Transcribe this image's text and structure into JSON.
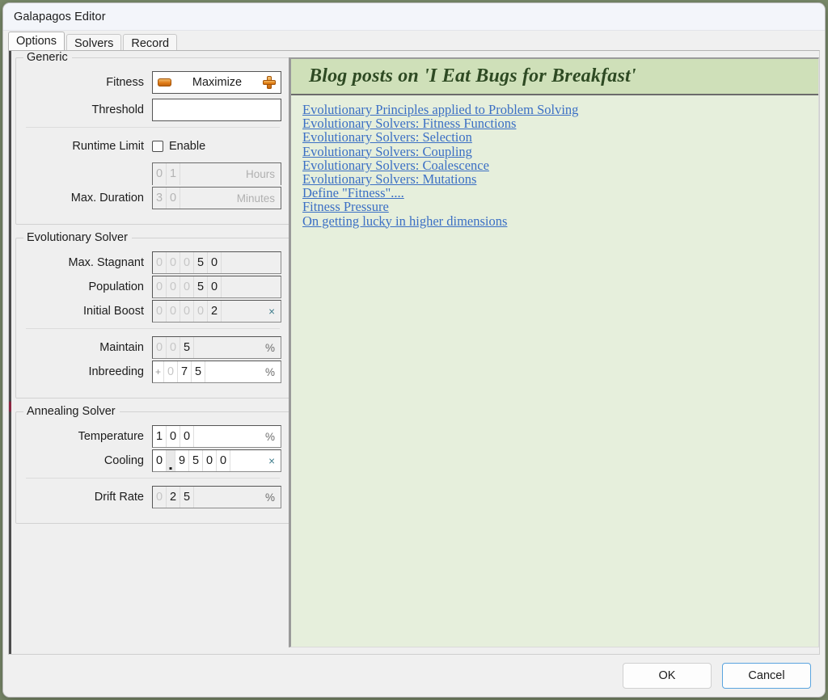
{
  "window": {
    "title": "Galapagos Editor"
  },
  "tabs": [
    {
      "label": "Options",
      "active": true
    },
    {
      "label": "Solvers",
      "active": false
    },
    {
      "label": "Record",
      "active": false
    }
  ],
  "generic": {
    "title": "Generic",
    "fitness": {
      "label": "Fitness",
      "value": "Maximize",
      "left_icon": "minimize-icon",
      "right_icon": "maximize-icon"
    },
    "threshold": {
      "label": "Threshold",
      "value": ""
    },
    "runtime_limit": {
      "label": "Runtime Limit",
      "checkbox_label": "Enable",
      "checked": false
    },
    "max_duration": {
      "label": "Max. Duration",
      "hours": {
        "digits": [
          "0",
          "1"
        ],
        "faint": [
          true,
          false
        ],
        "unit": "Hours"
      },
      "minutes": {
        "digits": [
          "3",
          "0"
        ],
        "faint": [
          false,
          false
        ],
        "unit": "Minutes"
      }
    }
  },
  "evolutionary": {
    "title": "Evolutionary Solver",
    "max_stagnant": {
      "label": "Max. Stagnant",
      "digits": [
        "0",
        "0",
        "0",
        "5",
        "0"
      ],
      "faint": [
        true,
        true,
        true,
        false,
        false
      ],
      "unit": ""
    },
    "population": {
      "label": "Population",
      "digits": [
        "0",
        "0",
        "0",
        "5",
        "0"
      ],
      "faint": [
        true,
        true,
        true,
        false,
        false
      ],
      "unit": ""
    },
    "initial_boost": {
      "label": "Initial Boost",
      "digits": [
        "0",
        "0",
        "0",
        "0",
        "2"
      ],
      "faint": [
        true,
        true,
        true,
        true,
        false
      ],
      "unit": "×"
    },
    "maintain": {
      "label": "Maintain",
      "digits": [
        "0",
        "0",
        "5"
      ],
      "faint": [
        true,
        true,
        false
      ],
      "unit": "%"
    },
    "inbreeding": {
      "label": "Inbreeding",
      "sign": "+",
      "digits": [
        "0",
        "7",
        "5"
      ],
      "faint": [
        true,
        false,
        false
      ],
      "unit": "%"
    }
  },
  "annealing": {
    "title": "Annealing Solver",
    "temperature": {
      "label": "Temperature",
      "digits": [
        "1",
        "0",
        "0"
      ],
      "faint": [
        false,
        false,
        false
      ],
      "unit": "%"
    },
    "cooling": {
      "label": "Cooling",
      "digits": [
        "0",
        ".",
        "9",
        "5",
        "0",
        "0"
      ],
      "faint": [
        false,
        false,
        false,
        false,
        false,
        false
      ],
      "unit": "×"
    },
    "drift_rate": {
      "label": "Drift Rate",
      "digits": [
        "0",
        "2",
        "5"
      ],
      "faint": [
        true,
        false,
        false
      ],
      "unit": "%"
    }
  },
  "blog": {
    "header": "Blog posts on 'I Eat Bugs for Breakfast'",
    "links": [
      "Evolutionary Principles applied to Problem Solving",
      "Evolutionary Solvers: Fitness Functions",
      "Evolutionary Solvers: Selection",
      "Evolutionary Solvers: Coupling",
      "Evolutionary Solvers: Coalescence",
      "Evolutionary Solvers: Mutations",
      "Define \"Fitness\"....",
      "Fitness Pressure",
      "On getting lucky in higher dimensions"
    ]
  },
  "footer": {
    "ok": "OK",
    "cancel": "Cancel"
  },
  "colors": {
    "accent_orange": "#e07c18",
    "link_blue": "#3b6fc4",
    "panel_green": "#e6efdc",
    "header_green": "#cfe0b9",
    "header_text_green": "#2e4a23",
    "focus_blue": "#5aa4df"
  }
}
